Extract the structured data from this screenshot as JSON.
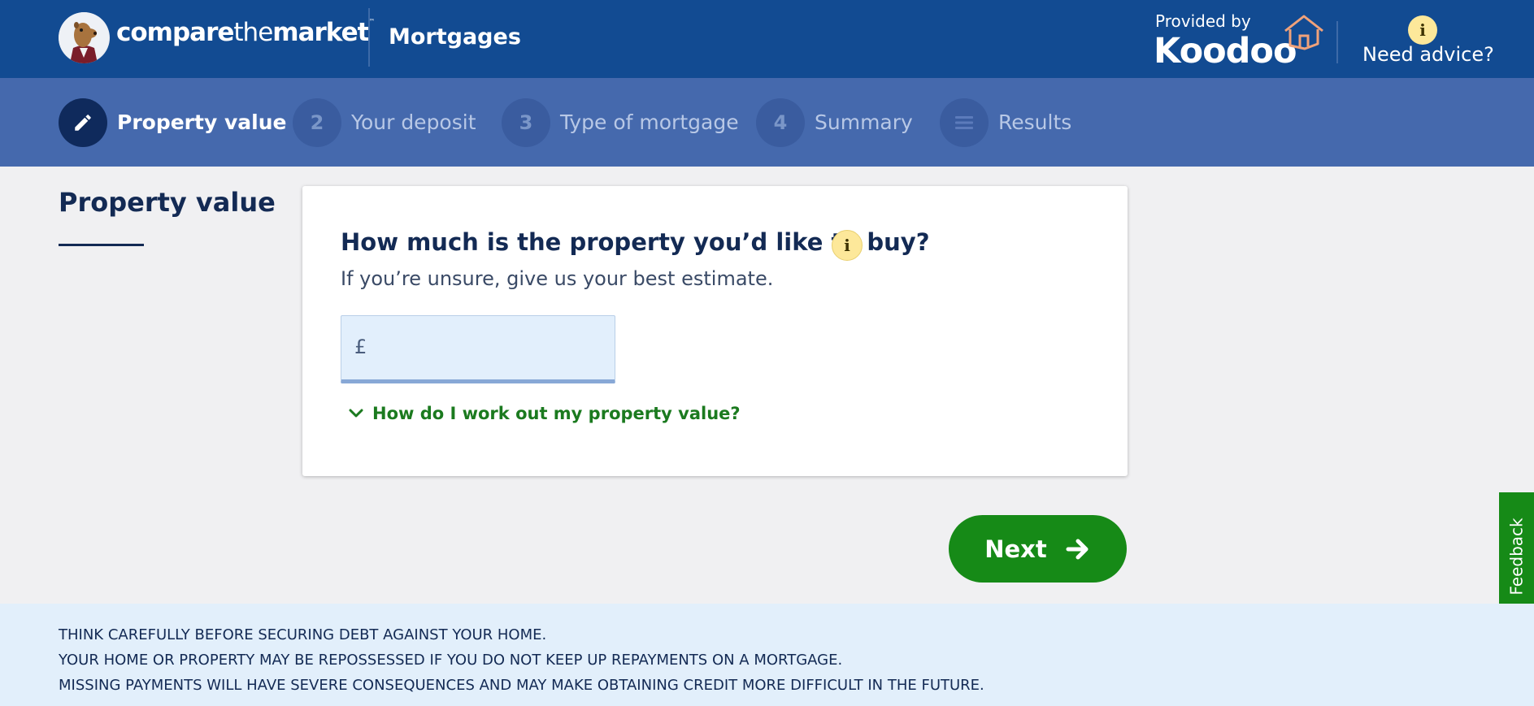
{
  "header": {
    "brand_bold_1": "compare",
    "brand_thin": "the",
    "brand_bold_2": "market",
    "brand_tm": "™",
    "section_title": "Mortgages",
    "provided_by": "Provided by",
    "partner_name": "Koodoo",
    "advice_icon": "i",
    "advice_label": "Need advice?"
  },
  "steps": [
    {
      "marker": "",
      "icon": "pencil-icon",
      "label": "Property value",
      "state": "active"
    },
    {
      "marker": "2",
      "label": "Your deposit",
      "state": "upcoming"
    },
    {
      "marker": "3",
      "label": "Type of mortgage",
      "state": "upcoming"
    },
    {
      "marker": "4",
      "label": "Summary",
      "state": "upcoming"
    },
    {
      "marker": "",
      "icon": "list-icon",
      "label": "Results",
      "state": "upcoming"
    }
  ],
  "page": {
    "title": "Property value"
  },
  "card": {
    "question": "How much is the property you’d like to buy?",
    "info_icon": "i",
    "hint": "If you’re unsure, give us your best estimate.",
    "currency_symbol": "£",
    "input_value": "",
    "help_link": "How do I work out my property value?"
  },
  "actions": {
    "next_label": "Next"
  },
  "feedback": {
    "label": "Feedback"
  },
  "footer": {
    "lines": [
      "THINK CAREFULLY BEFORE SECURING DEBT AGAINST YOUR HOME.",
      "YOUR HOME OR PROPERTY MAY BE REPOSSESSED IF YOU DO NOT KEEP UP REPAYMENTS ON A MORTGAGE.",
      "MISSING PAYMENTS WILL HAVE SEVERE CONSEQUENCES AND MAY MAKE OBTAINING CREDIT MORE DIFFICULT IN THE FUTURE."
    ]
  },
  "colors": {
    "header_bg": "#124b92",
    "steps_bg": "#4569ad",
    "active_step": "#0f2a5c",
    "primary_green": "#168a17",
    "info_yellow": "#fde89a",
    "footer_bg": "#e2effb"
  }
}
